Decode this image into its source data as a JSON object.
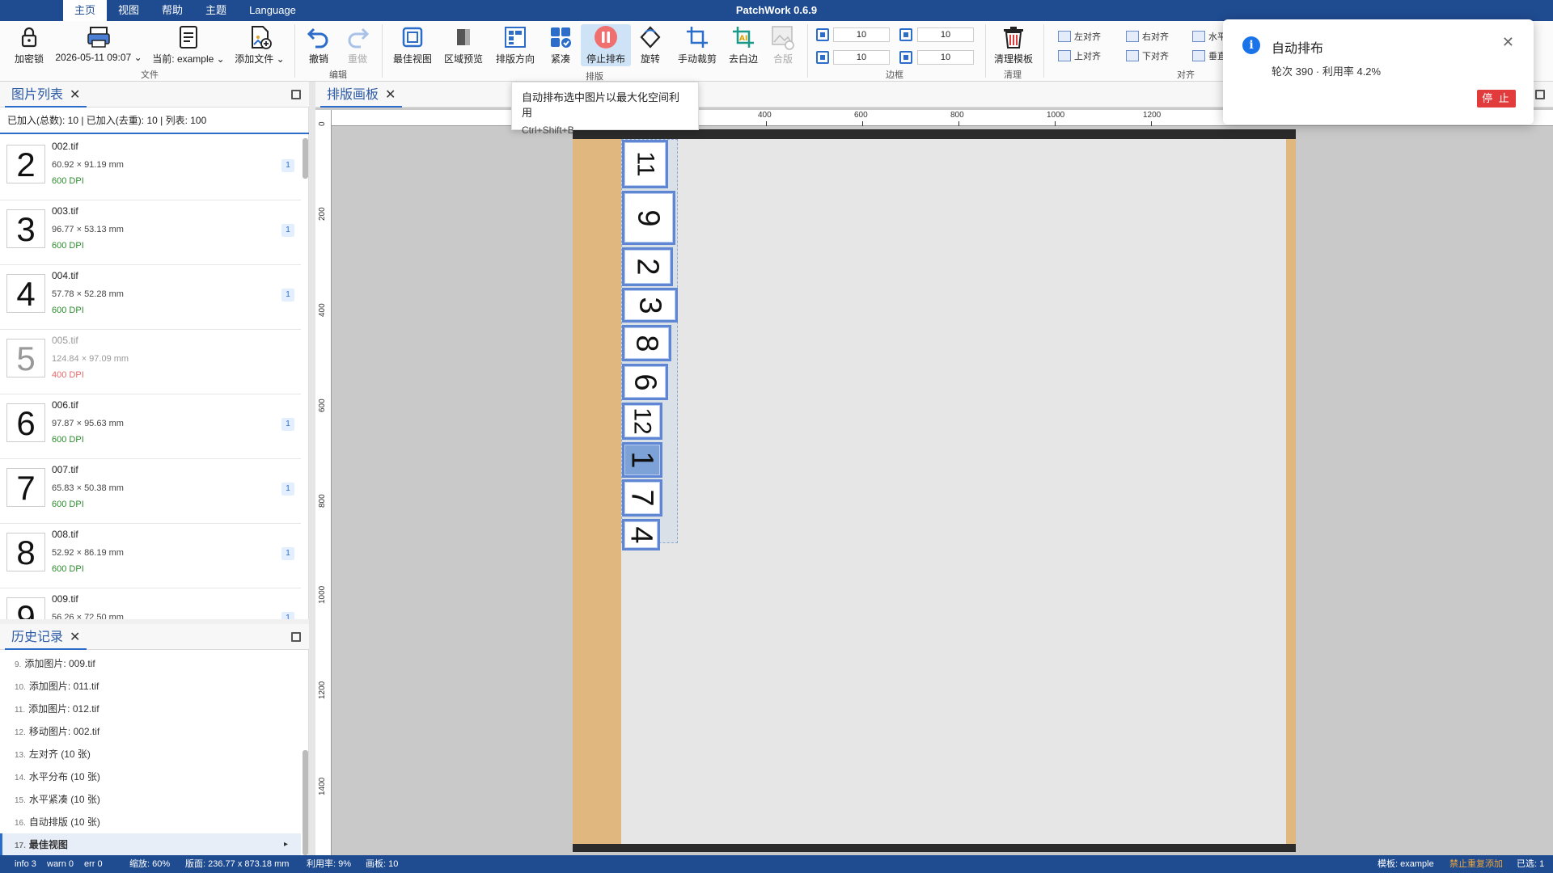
{
  "app": {
    "title": "PatchWork 0.6.9"
  },
  "menu": [
    "主页",
    "视图",
    "帮助",
    "主题",
    "Language"
  ],
  "ribbon": {
    "lock": "加密锁",
    "date": "2026-05-11 09:07",
    "current": "当前: example",
    "add_file": "添加文件",
    "group_file": "文件",
    "undo": "撤销",
    "redo": "重做",
    "group_edit": "编辑",
    "best_view": "最佳视图",
    "area_preview": "区域预览",
    "layout_dir": "排版方向",
    "compact": "紧凑",
    "stop_layout": "停止排布",
    "group_layout": "排版",
    "rotate": "旋转",
    "manual_crop": "手动裁剪",
    "remove_white": "去白边",
    "merge": "合版",
    "border_values": [
      "10",
      "10",
      "10",
      "10"
    ],
    "group_border": "边框",
    "clear_template": "清理模板",
    "group_clear": "清理",
    "align": {
      "left": "左对齐",
      "top": "上对齐",
      "right": "右对齐",
      "bottom": "下对齐",
      "hcenter": "水平",
      "vcenter": "垂直"
    },
    "group_align": "对齐"
  },
  "image_list": {
    "tab": "图片列表",
    "summary": "已加入(总数): 10 | 已加入(去重): 10 | 列表: 100",
    "items": [
      {
        "thumb": "2",
        "name": "002.tif",
        "size": "60.92 × 91.19 mm",
        "dpi": "600 DPI",
        "count": "1"
      },
      {
        "thumb": "3",
        "name": "003.tif",
        "size": "96.77 × 53.13 mm",
        "dpi": "600 DPI",
        "count": "1"
      },
      {
        "thumb": "4",
        "name": "004.tif",
        "size": "57.78 × 52.28 mm",
        "dpi": "600 DPI",
        "count": "1"
      },
      {
        "thumb": "5",
        "name": "005.tif",
        "size": "124.84 × 97.09 mm",
        "dpi": "400 DPI",
        "count": ""
      },
      {
        "thumb": "6",
        "name": "006.tif",
        "size": "97.87 × 95.63 mm",
        "dpi": "600 DPI",
        "count": "1"
      },
      {
        "thumb": "7",
        "name": "007.tif",
        "size": "65.83 × 50.38 mm",
        "dpi": "600 DPI",
        "count": "1"
      },
      {
        "thumb": "8",
        "name": "008.tif",
        "size": "52.92 × 86.19 mm",
        "dpi": "600 DPI",
        "count": "1"
      },
      {
        "thumb": "9",
        "name": "009.tif",
        "size": "56.26 × 72.50 mm",
        "dpi": "",
        "count": "1"
      }
    ]
  },
  "history": {
    "tab": "历史记录",
    "items": [
      {
        "n": "9.",
        "text": "添加图片: 009.tif"
      },
      {
        "n": "10.",
        "text": "添加图片: 011.tif"
      },
      {
        "n": "11.",
        "text": "添加图片: 012.tif"
      },
      {
        "n": "12.",
        "text": "移动图片: 002.tif"
      },
      {
        "n": "13.",
        "text": "左对齐 (10 张)"
      },
      {
        "n": "14.",
        "text": "水平分布 (10 张)"
      },
      {
        "n": "15.",
        "text": "水平紧凑 (10 张)"
      },
      {
        "n": "16.",
        "text": "自动排版 (10 张)"
      },
      {
        "n": "17.",
        "text": "最佳视图"
      }
    ]
  },
  "canvas": {
    "tab": "排版画板",
    "hticks": [
      "400",
      "600",
      "800",
      "1000",
      "1200"
    ],
    "vticks": [
      "0",
      "200",
      "400",
      "600",
      "800",
      "1000",
      "1200",
      "1400"
    ],
    "pieces": [
      "11",
      "9",
      "2",
      "3",
      "8",
      "6",
      "12",
      "1",
      "7",
      "4"
    ]
  },
  "tooltip": {
    "text": "自动排布选中图片以最大化空间利用",
    "shortcut": "Ctrl+Shift+B"
  },
  "notification": {
    "title": "自动排布",
    "message": "轮次 390 · 利用率 4.2%",
    "stop": "停 止"
  },
  "status": {
    "info": "info 3",
    "warn": "warn 0",
    "err": "err 0",
    "zoom": "缩放: 60%",
    "board": "版面: 236.77 x 873.18 mm",
    "usage": "利用率: 9%",
    "boards": "画板: 10",
    "template": "模板: example",
    "no_dup": "禁止重复添加",
    "selected": "已选: 1"
  }
}
